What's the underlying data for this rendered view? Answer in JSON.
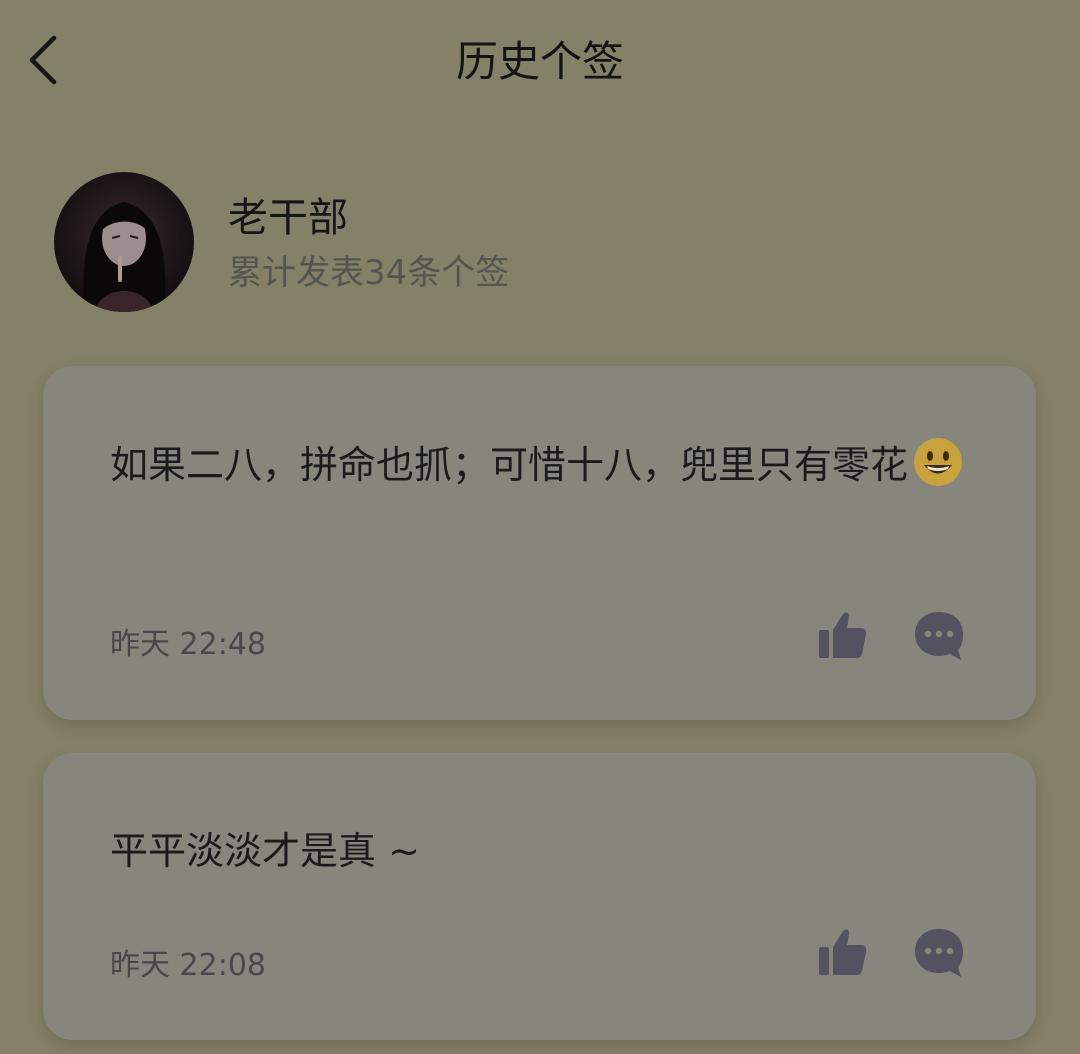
{
  "header": {
    "back_icon": "chevron-left-icon",
    "title": "历史个签"
  },
  "profile": {
    "name": "老干部",
    "stats": "累计发表34条个签"
  },
  "posts": [
    {
      "text": "如果二八，拼命也抓；可惜十八，兜里只有零花",
      "emoji": "grinning-face-emoji",
      "time": "昨天 22:48",
      "like_icon": "thumbs-up-icon",
      "comment_icon": "comment-bubble-icon"
    },
    {
      "text": "平平淡淡才是真 ~",
      "time": "昨天 22:08",
      "like_icon": "thumbs-up-icon",
      "comment_icon": "comment-bubble-icon"
    }
  ],
  "colors": {
    "background": "#858068",
    "card": "#87867d",
    "icon": "#535261"
  }
}
